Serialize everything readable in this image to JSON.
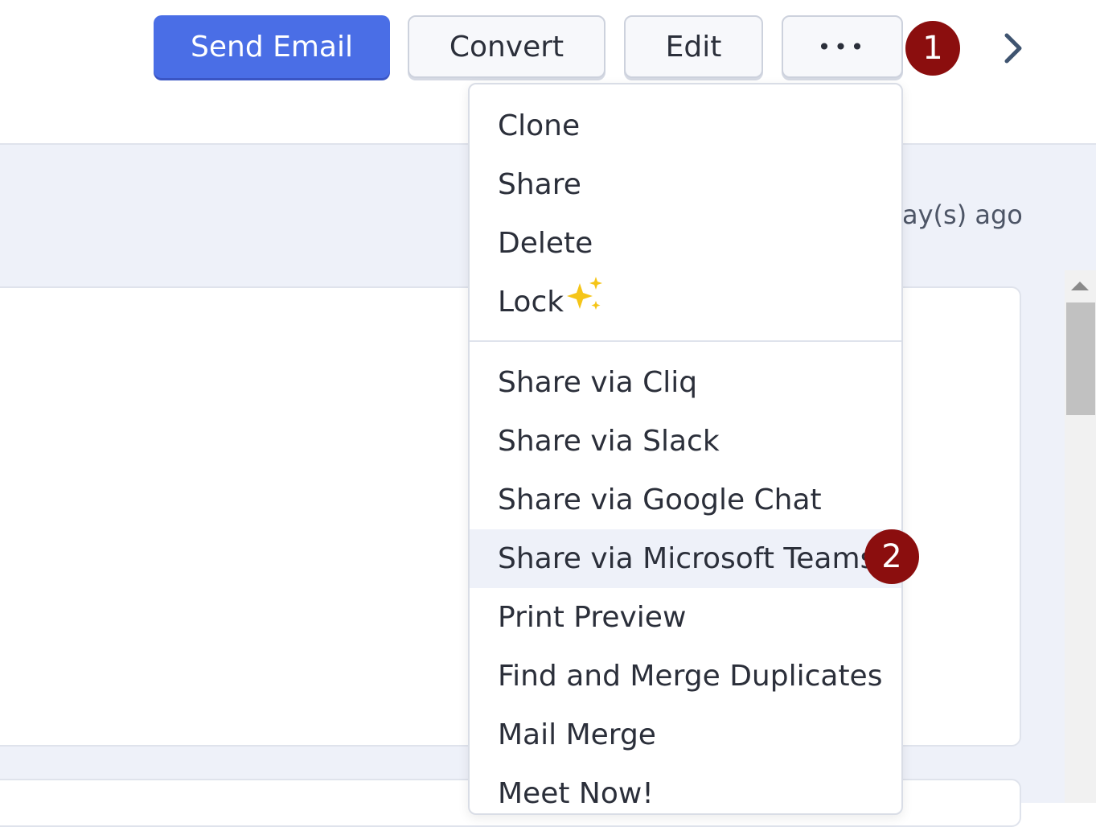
{
  "toolbar": {
    "send_email_label": "Send Email",
    "convert_label": "Convert",
    "edit_label": "Edit",
    "more_label": "•••"
  },
  "markers": {
    "first": "1",
    "second": "2"
  },
  "record": {
    "timestamp_fragment": "ay(s) ago"
  },
  "menu": {
    "items": [
      {
        "label": "Clone"
      },
      {
        "label": "Share"
      },
      {
        "label": "Delete"
      },
      {
        "label": "Lock",
        "icon": "sparkle-icon"
      },
      {
        "label": "Share via Cliq"
      },
      {
        "label": "Share via Slack"
      },
      {
        "label": "Share via Google Chat"
      },
      {
        "label": "Share via Microsoft Teams",
        "highlighted": true
      },
      {
        "label": "Print Preview"
      },
      {
        "label": "Find and Merge Duplicates"
      },
      {
        "label": "Mail Merge"
      },
      {
        "label": "Meet Now!"
      }
    ]
  },
  "colors": {
    "primary": "#4a6ee6",
    "marker": "#8b0e0e",
    "highlight": "#eef1f9",
    "sparkle": "#f5c518"
  },
  "icons": {
    "next": "chevron-right-icon",
    "lock_badge": "sparkle-icon"
  }
}
